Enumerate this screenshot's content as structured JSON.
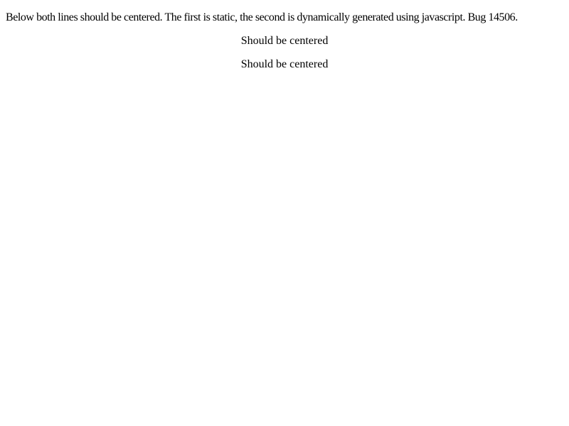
{
  "intro_text": "Below both lines should be centered. The first is static, the second is dynamically generated using javascript. Bug 14506.",
  "lines": [
    "Should be centered",
    "Should be centered"
  ]
}
